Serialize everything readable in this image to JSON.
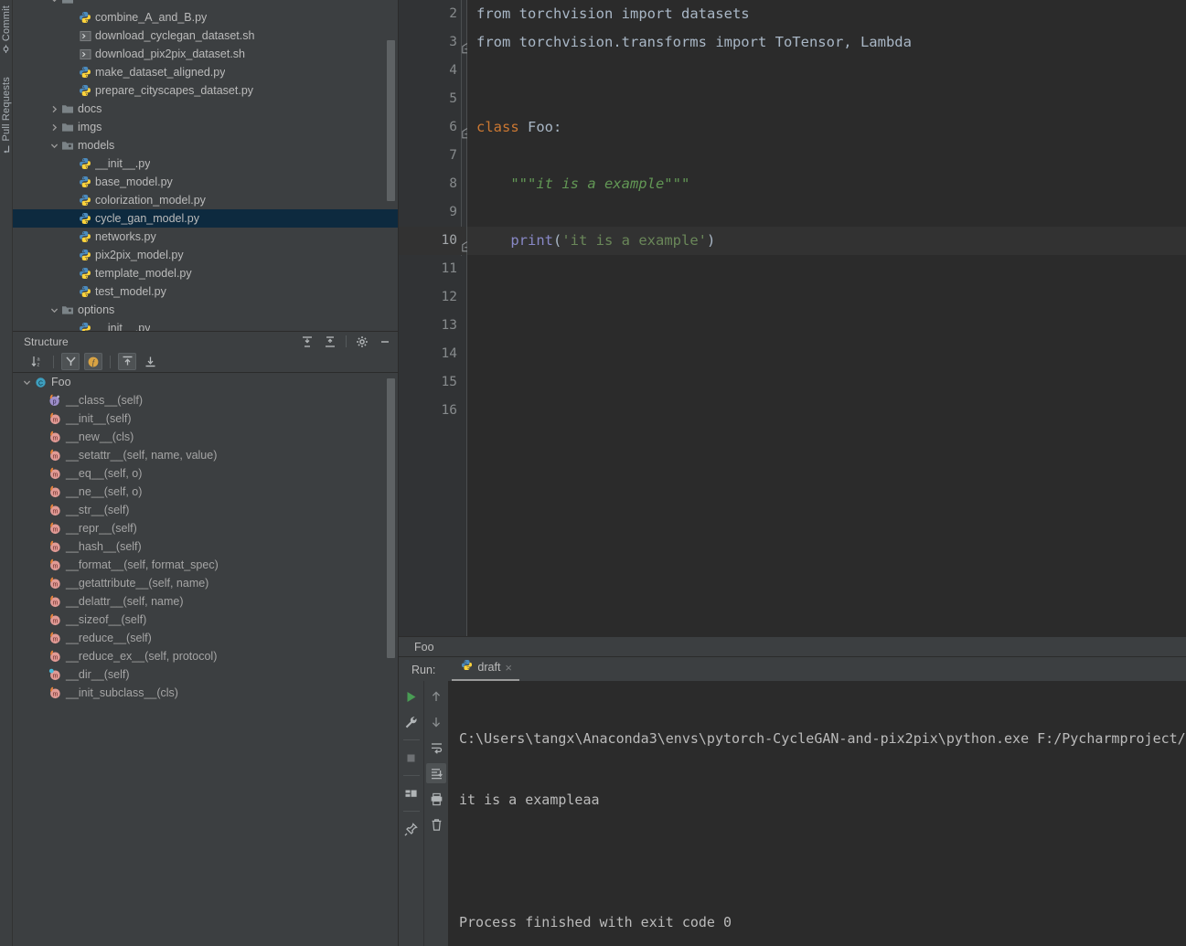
{
  "left_strip": {
    "tabs": [
      {
        "label": "Commit",
        "icon": "commit-icon"
      },
      {
        "label": "Pull Requests",
        "icon": "pull-request-icon"
      }
    ]
  },
  "project_tree": {
    "rows": [
      {
        "indent": 2,
        "arrow": "down",
        "icon": "folder-icon",
        "label": "",
        "type": "folder",
        "selected": false,
        "clipped": true
      },
      {
        "indent": 3,
        "arrow": "none",
        "icon": "python-icon",
        "label": "combine_A_and_B.py",
        "type": "file",
        "selected": false
      },
      {
        "indent": 3,
        "arrow": "none",
        "icon": "shell-icon",
        "label": "download_cyclegan_dataset.sh",
        "type": "file",
        "selected": false
      },
      {
        "indent": 3,
        "arrow": "none",
        "icon": "shell-icon",
        "label": "download_pix2pix_dataset.sh",
        "type": "file",
        "selected": false
      },
      {
        "indent": 3,
        "arrow": "none",
        "icon": "python-icon",
        "label": "make_dataset_aligned.py",
        "type": "file",
        "selected": false
      },
      {
        "indent": 3,
        "arrow": "none",
        "icon": "python-icon",
        "label": "prepare_cityscapes_dataset.py",
        "type": "file",
        "selected": false
      },
      {
        "indent": 2,
        "arrow": "right",
        "icon": "folder-icon",
        "label": "docs",
        "type": "folder",
        "selected": false
      },
      {
        "indent": 2,
        "arrow": "right",
        "icon": "folder-icon",
        "label": "imgs",
        "type": "folder",
        "selected": false
      },
      {
        "indent": 2,
        "arrow": "down",
        "icon": "package-icon",
        "label": "models",
        "type": "folder",
        "selected": false
      },
      {
        "indent": 3,
        "arrow": "none",
        "icon": "python-icon",
        "label": "__init__.py",
        "type": "file",
        "selected": false
      },
      {
        "indent": 3,
        "arrow": "none",
        "icon": "python-icon",
        "label": "base_model.py",
        "type": "file",
        "selected": false
      },
      {
        "indent": 3,
        "arrow": "none",
        "icon": "python-icon",
        "label": "colorization_model.py",
        "type": "file",
        "selected": false
      },
      {
        "indent": 3,
        "arrow": "none",
        "icon": "python-icon",
        "label": "cycle_gan_model.py",
        "type": "file",
        "selected": true
      },
      {
        "indent": 3,
        "arrow": "none",
        "icon": "python-icon",
        "label": "networks.py",
        "type": "file",
        "selected": false
      },
      {
        "indent": 3,
        "arrow": "none",
        "icon": "python-icon",
        "label": "pix2pix_model.py",
        "type": "file",
        "selected": false
      },
      {
        "indent": 3,
        "arrow": "none",
        "icon": "python-icon",
        "label": "template_model.py",
        "type": "file",
        "selected": false
      },
      {
        "indent": 3,
        "arrow": "none",
        "icon": "python-icon",
        "label": "test_model.py",
        "type": "file",
        "selected": false
      },
      {
        "indent": 2,
        "arrow": "down",
        "icon": "package-icon",
        "label": "options",
        "type": "folder",
        "selected": false
      },
      {
        "indent": 3,
        "arrow": "none",
        "icon": "python-icon",
        "label": "__init__.py",
        "type": "file",
        "selected": false,
        "clipped": true
      }
    ]
  },
  "structure": {
    "title": "Structure",
    "header_buttons": [
      {
        "name": "expand-all-icon",
        "tooltip": "Expand All"
      },
      {
        "name": "collapse-all-icon",
        "tooltip": "Collapse All"
      },
      {
        "name": "gear-icon",
        "tooltip": "Settings"
      },
      {
        "name": "minimize-icon",
        "tooltip": "Hide"
      }
    ],
    "toolbar_buttons": [
      {
        "name": "sort-alphabetically-icon",
        "active": false
      },
      {
        "name": "sort-by-visibility-icon",
        "active": true
      },
      {
        "name": "show-fields-icon",
        "active": true
      },
      {
        "name": "show-inherited-icon",
        "active": true
      },
      {
        "name": "show-imported-icon",
        "active": false
      }
    ],
    "items": [
      {
        "depth": 0,
        "icon": "class-icon",
        "label": "Foo",
        "expanded": true
      },
      {
        "depth": 1,
        "icon": "property-icon",
        "label": "__class__(self)"
      },
      {
        "depth": 1,
        "icon": "method-icon",
        "label": "__init__(self)"
      },
      {
        "depth": 1,
        "icon": "method-icon",
        "label": "__new__(cls)"
      },
      {
        "depth": 1,
        "icon": "method-icon",
        "label": "__setattr__(self, name, value)"
      },
      {
        "depth": 1,
        "icon": "method-icon",
        "label": "__eq__(self, o)"
      },
      {
        "depth": 1,
        "icon": "method-icon",
        "label": "__ne__(self, o)"
      },
      {
        "depth": 1,
        "icon": "method-icon",
        "label": "__str__(self)"
      },
      {
        "depth": 1,
        "icon": "method-icon",
        "label": "__repr__(self)"
      },
      {
        "depth": 1,
        "icon": "method-icon",
        "label": "__hash__(self)"
      },
      {
        "depth": 1,
        "icon": "method-icon",
        "label": "__format__(self, format_spec)"
      },
      {
        "depth": 1,
        "icon": "method-icon",
        "label": "__getattribute__(self, name)"
      },
      {
        "depth": 1,
        "icon": "method-icon",
        "label": "__delattr__(self, name)"
      },
      {
        "depth": 1,
        "icon": "method-icon",
        "label": "__sizeof__(self)"
      },
      {
        "depth": 1,
        "icon": "method-icon",
        "label": "__reduce__(self)"
      },
      {
        "depth": 1,
        "icon": "method-icon",
        "label": "__reduce_ex__(self, protocol)"
      },
      {
        "depth": 1,
        "icon": "method-icon",
        "label": "__dir__(self)",
        "marker": "blue"
      },
      {
        "depth": 1,
        "icon": "method-icon",
        "label": "__init_subclass__(cls)"
      }
    ]
  },
  "editor": {
    "lines": [
      {
        "number": "2",
        "current": false,
        "fold": false,
        "bulb": false,
        "tokens": [
          {
            "t": "from ",
            "c": "imp"
          },
          {
            "t": "torchvision ",
            "c": "imp"
          },
          {
            "t": "import ",
            "c": "imp"
          },
          {
            "t": "datasets",
            "c": "imp"
          }
        ]
      },
      {
        "number": "3",
        "current": false,
        "fold": true,
        "bulb": false,
        "tokens": [
          {
            "t": "from ",
            "c": "imp"
          },
          {
            "t": "torchvision.transforms ",
            "c": "imp"
          },
          {
            "t": "import ",
            "c": "imp"
          },
          {
            "t": "ToTensor, Lambda",
            "c": "imp"
          }
        ]
      },
      {
        "number": "4",
        "current": false,
        "fold": false,
        "bulb": false,
        "tokens": []
      },
      {
        "number": "5",
        "current": false,
        "fold": false,
        "bulb": false,
        "tokens": []
      },
      {
        "number": "6",
        "current": false,
        "fold": true,
        "bulb": false,
        "tokens": [
          {
            "t": "class ",
            "c": "kw"
          },
          {
            "t": "Foo",
            "c": "cls"
          },
          {
            "t": ":",
            "c": "punc"
          }
        ]
      },
      {
        "number": "7",
        "current": false,
        "fold": false,
        "bulb": false,
        "tokens": []
      },
      {
        "number": "8",
        "current": false,
        "fold": false,
        "bulb": false,
        "tokens": [
          {
            "t": "    \"\"\"it is a example\"\"\"",
            "c": "doc"
          }
        ]
      },
      {
        "number": "9",
        "current": false,
        "fold": false,
        "bulb": false,
        "tokens": []
      },
      {
        "number": "10",
        "current": true,
        "fold": true,
        "bulb": true,
        "tokens": [
          {
            "t": "    ",
            "c": "punc"
          },
          {
            "t": "print",
            "c": "fn"
          },
          {
            "t": "(",
            "c": "punc"
          },
          {
            "t": "'it is a example'",
            "c": "str"
          },
          {
            "t": ")",
            "c": "punc"
          }
        ]
      },
      {
        "number": "11",
        "current": false,
        "fold": false,
        "bulb": false,
        "tokens": []
      },
      {
        "number": "12",
        "current": false,
        "fold": false,
        "bulb": false,
        "tokens": []
      },
      {
        "number": "13",
        "current": false,
        "fold": false,
        "bulb": false,
        "tokens": []
      },
      {
        "number": "14",
        "current": false,
        "fold": false,
        "bulb": false,
        "tokens": []
      },
      {
        "number": "15",
        "current": false,
        "fold": false,
        "bulb": false,
        "tokens": []
      },
      {
        "number": "16",
        "current": false,
        "fold": false,
        "bulb": false,
        "tokens": []
      }
    ]
  },
  "breadcrumb": {
    "label": "Foo"
  },
  "run_panel": {
    "label": "Run:",
    "tab": {
      "name": "draft",
      "icon": "python-icon",
      "close": "×"
    },
    "left_buttons": [
      {
        "name": "rerun-button",
        "icon": "play-icon"
      },
      {
        "name": "edit-configuration-button",
        "icon": "wrench-icon"
      },
      {
        "name": "stop-button",
        "icon": "stop-icon"
      },
      {
        "name": "layout-settings-button",
        "icon": "layout-icon"
      },
      {
        "name": "pin-tab-button",
        "icon": "pin-icon"
      }
    ],
    "right_buttons": [
      {
        "name": "up-the-stack-trace-button",
        "icon": "arrow-up-icon"
      },
      {
        "name": "down-the-stack-trace-button",
        "icon": "arrow-down-icon"
      },
      {
        "name": "soft-wrap-button",
        "icon": "soft-wrap-icon"
      },
      {
        "name": "scroll-to-end-button",
        "icon": "scroll-to-end-icon",
        "active": true
      },
      {
        "name": "print-button",
        "icon": "printer-icon"
      },
      {
        "name": "clear-all-button",
        "icon": "trash-icon"
      }
    ],
    "console": {
      "command": "C:\\Users\\tangx\\Anaconda3\\envs\\pytorch-CycleGAN-and-pix2pix\\python.exe F:/Pycharmproject/pytorch-CycleGAN-and-p",
      "output": "it is a exampleaa",
      "exit": "Process finished with exit code 0"
    }
  },
  "colors": {
    "panel_bg": "#3c3f41",
    "editor_bg": "#2b2b2b",
    "gutter_bg": "#313335",
    "selection_bg": "#0d2a3f",
    "current_line_bg": "#323232",
    "text": "#bbbbbb",
    "keyword": "#cc7832",
    "string": "#6a8759",
    "docstring": "#629755",
    "function": "#8888c6",
    "code_default": "#a9b7c6",
    "accent_green": "#499c54",
    "accent_yellow": "#d9a343"
  }
}
